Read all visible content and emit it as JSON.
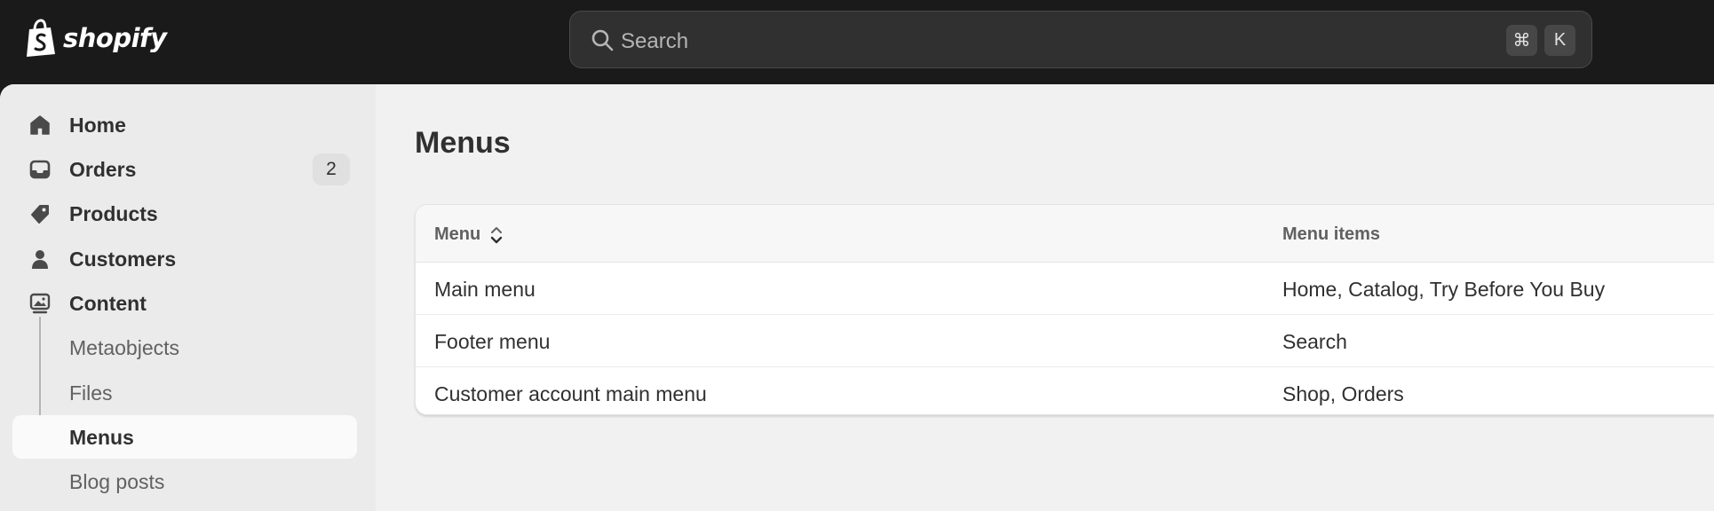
{
  "brand": {
    "name": "shopify"
  },
  "search": {
    "placeholder": "Search",
    "shortcut_cmd": "⌘",
    "shortcut_key": "K"
  },
  "sidebar": {
    "items": [
      {
        "label": "Home",
        "icon": "home-icon"
      },
      {
        "label": "Orders",
        "icon": "inbox-icon",
        "badge": "2"
      },
      {
        "label": "Products",
        "icon": "tag-icon"
      },
      {
        "label": "Customers",
        "icon": "person-icon"
      },
      {
        "label": "Content",
        "icon": "image-content-icon"
      }
    ],
    "sub_items": [
      {
        "label": "Metaobjects"
      },
      {
        "label": "Files"
      },
      {
        "label": "Menus",
        "active": true
      },
      {
        "label": "Blog posts"
      }
    ]
  },
  "page": {
    "title": "Menus"
  },
  "table": {
    "columns": [
      "Menu",
      "Menu items"
    ],
    "rows": [
      {
        "menu": "Main menu",
        "items": "Home, Catalog, Try Before You Buy"
      },
      {
        "menu": "Footer menu",
        "items": "Search"
      },
      {
        "menu": "Customer account main menu",
        "items": "Shop, Orders"
      }
    ]
  },
  "colors": {
    "topbar": "#1a1a1a",
    "sidebar": "#ebebeb",
    "main": "#f1f1f1",
    "card": "#ffffff",
    "text": "#303030",
    "muted": "#616161"
  }
}
